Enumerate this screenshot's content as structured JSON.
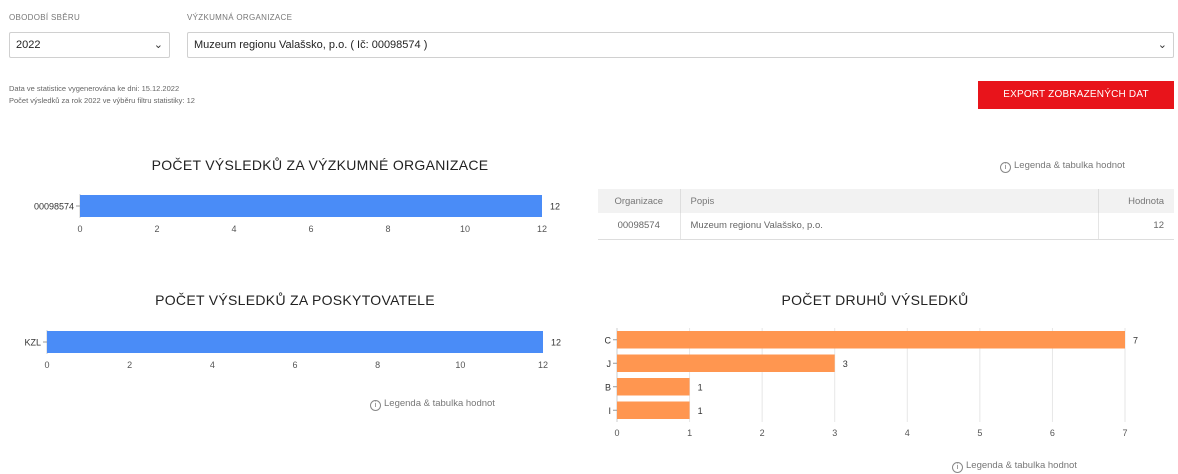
{
  "filters": {
    "year_label": "OBODOBÍ SBĚRU",
    "year_value": "2022",
    "org_label": "VÝZKUMNÁ ORGANIZACE",
    "org_value": "Muzeum regionu Valašsko, p.o. ( Ič: 00098574 )"
  },
  "info": {
    "line1": "Data ve statistice vygenerována ke dni: 15.12.2022",
    "line2": "Počet výsledků za rok 2022 ve výběru filtru statistiky: 12"
  },
  "export_label": "EXPORT ZOBRAZENÝCH DAT",
  "legend_link": "Legenda & tabulka hodnot",
  "legend_icon": "info-icon",
  "colors": {
    "blue": "#4a8cf7",
    "orange": "#ff9650",
    "accent": "#e8141b"
  },
  "chart_org": {
    "title": "POČET VÝSLEDKŮ ZA VÝZKUMNÉ ORGANIZACE",
    "chart_data": {
      "type": "bar",
      "orientation": "horizontal",
      "categories": [
        "00098574"
      ],
      "values": [
        12
      ],
      "xlim": [
        0,
        12
      ],
      "ticks": [
        0,
        2,
        4,
        6,
        8,
        10,
        12
      ]
    }
  },
  "chart_provider": {
    "title": "POČET VÝSLEDKŮ ZA POSKYTOVATELE",
    "chart_data": {
      "type": "bar",
      "orientation": "horizontal",
      "categories": [
        "KZL"
      ],
      "values": [
        12
      ],
      "xlim": [
        0,
        12
      ],
      "ticks": [
        0,
        2,
        4,
        6,
        8,
        10,
        12
      ]
    }
  },
  "chart_types": {
    "title": "POČET DRUHŮ VÝSLEDKŮ",
    "chart_data": {
      "type": "bar",
      "orientation": "horizontal",
      "categories": [
        "C",
        "J",
        "B",
        "I"
      ],
      "values": [
        7,
        3,
        1,
        1
      ],
      "xlim": [
        0,
        7
      ],
      "ticks": [
        0,
        1,
        2,
        3,
        4,
        5,
        6,
        7
      ]
    }
  },
  "table": {
    "headers": [
      "Organizace",
      "Popis",
      "Hodnota"
    ],
    "rows": [
      [
        "00098574",
        "Muzeum regionu Valašsko, p.o.",
        "12"
      ]
    ]
  }
}
